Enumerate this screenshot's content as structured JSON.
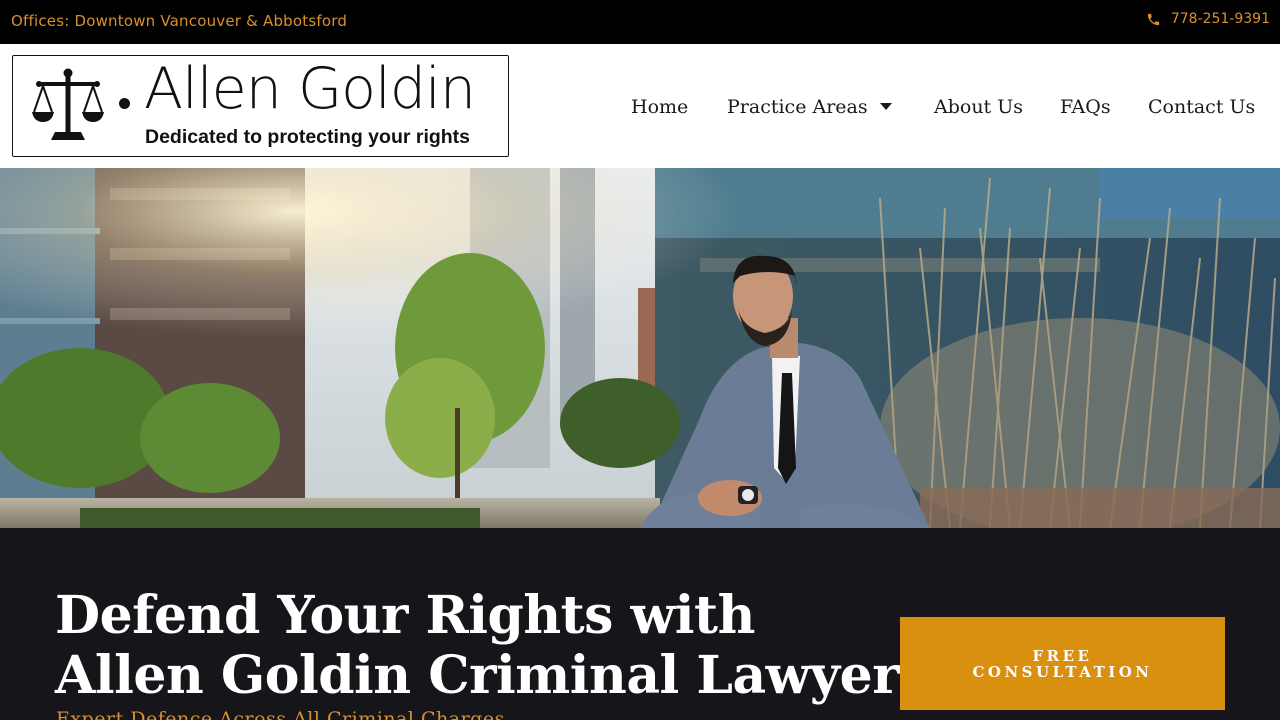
{
  "topbar": {
    "offices": "Offices: Downtown Vancouver & Abbotsford",
    "phone": "778-251-9391",
    "accent_color": "#d9902a"
  },
  "logo": {
    "name": "Allen Goldin",
    "tagline": "Dedicated to protecting your rights"
  },
  "nav": {
    "items": [
      {
        "label": "Home"
      },
      {
        "label": "Practice Areas",
        "has_dropdown": true
      },
      {
        "label": "About Us"
      },
      {
        "label": "FAQs"
      },
      {
        "label": "Contact Us"
      }
    ]
  },
  "hero": {
    "headline_line1": "Defend Your Rights with",
    "headline_line2": "Allen Goldin Criminal Lawyer",
    "subline": "Expert Defence Across All Criminal Charges",
    "cta_line1": "FREE",
    "cta_line2": "CONSULTATION",
    "cta_color": "#d9900f",
    "background_color": "#16151a"
  }
}
